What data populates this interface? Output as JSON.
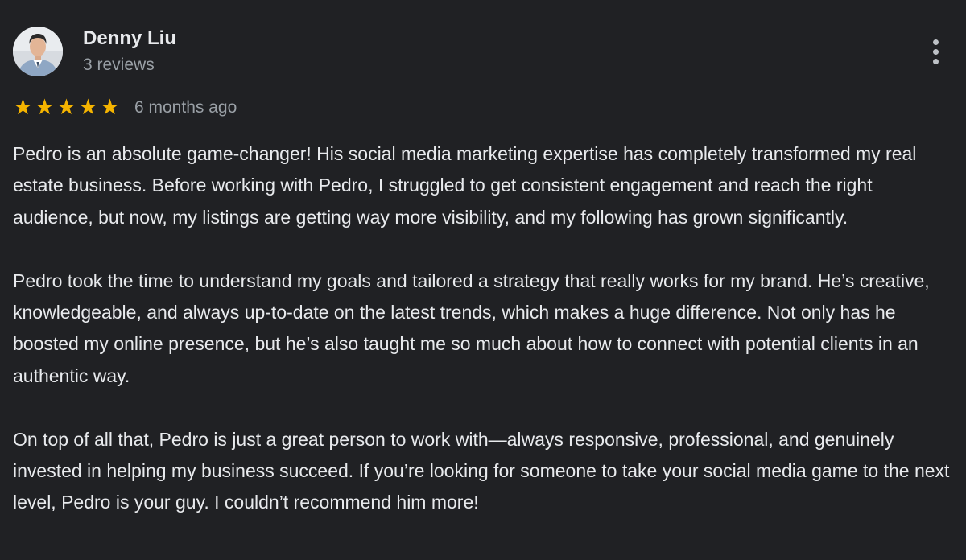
{
  "reviewer": {
    "name": "Denny Liu",
    "review_count": "3 reviews",
    "avatar_icon": "person-avatar"
  },
  "menu": {
    "icon": "more-vert-icon"
  },
  "rating": {
    "stars": 5,
    "max_stars": 5,
    "star_color": "#f5b400",
    "time": "6 months ago"
  },
  "review": {
    "paragraphs": [
      "Pedro is an absolute game-changer! His social media marketing expertise has completely transformed my real estate business. Before working with Pedro, I struggled to get consistent engagement and reach the right audience, but now, my listings are getting way more visibility, and my following has grown significantly.",
      "Pedro took the time to understand my goals and tailored a strategy that really works for my brand. He’s creative, knowledgeable, and always up-to-date on the latest trends, which makes a huge difference. Not only has he boosted my online presence, but he’s also taught me so much about how to connect with potential clients in an authentic way.",
      "On top of all that, Pedro is just a great person to work with—always responsive, professional, and genuinely invested in helping my business succeed. If you’re looking for someone to take your social media game to the next level, Pedro is your guy. I couldn’t recommend him more!"
    ]
  },
  "colors": {
    "background": "#202124",
    "primary_text": "#e8eaed",
    "secondary_text": "#9aa0a6"
  }
}
